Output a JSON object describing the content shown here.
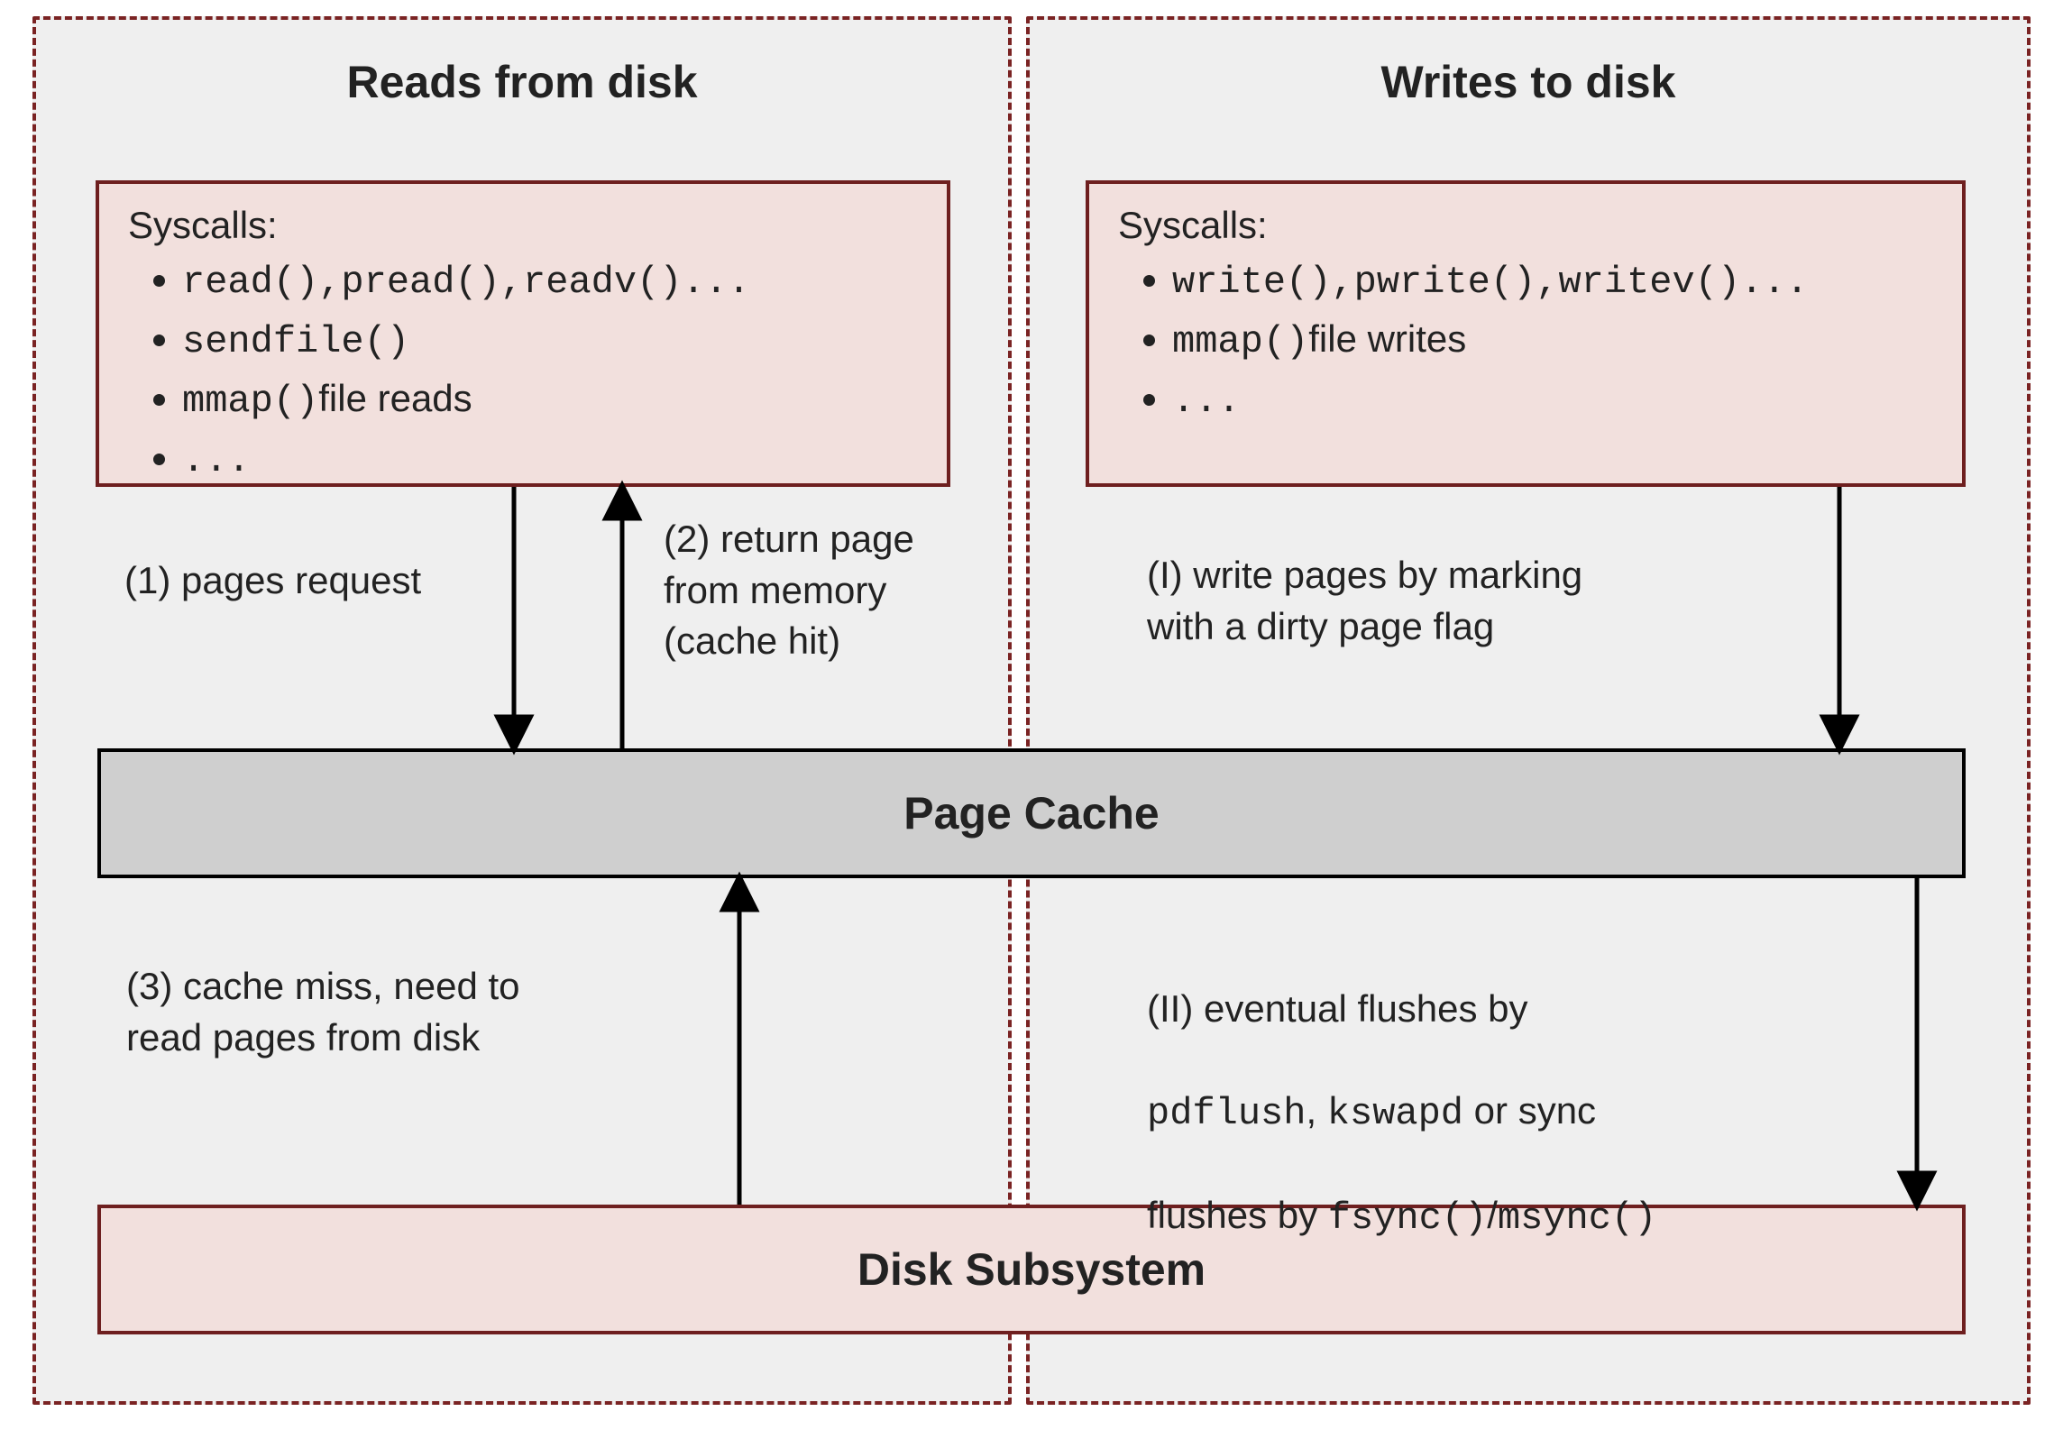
{
  "reads": {
    "title": "Reads from disk",
    "syscalls_header": "Syscalls:",
    "syscalls": [
      {
        "code": "read(),pread(),readv()...",
        "tail": ""
      },
      {
        "code": "sendfile()",
        "tail": ""
      },
      {
        "code": "mmap()",
        "tail": "file reads"
      },
      {
        "code": "...",
        "tail": ""
      }
    ]
  },
  "writes": {
    "title": "Writes to disk",
    "syscalls_header": "Syscalls:",
    "syscalls": [
      {
        "code": "write(),pwrite(),writev()...",
        "tail": ""
      },
      {
        "code": "mmap()",
        "tail": "file writes"
      },
      {
        "code": "...",
        "tail": ""
      }
    ]
  },
  "page_cache": {
    "label": "Page Cache"
  },
  "disk": {
    "label": "Disk Subsystem"
  },
  "labels": {
    "l1": "(1) pages request",
    "l2": "(2) return page\nfrom memory\n(cache hit)",
    "l3": "(3) cache miss, need to\nread pages from disk",
    "lI": "(I) write pages by marking\nwith a dirty page flag",
    "lII_a": "(II) eventual flushes by",
    "lII_b_code1": "pdflush",
    "lII_b_mid": ", ",
    "lII_b_code2": "kswapd",
    "lII_b_tail": " or sync",
    "lII_c_lead": "flushes by ",
    "lII_c_code1": "fsync()",
    "lII_c_sep": "/",
    "lII_c_code2": "msync()"
  }
}
